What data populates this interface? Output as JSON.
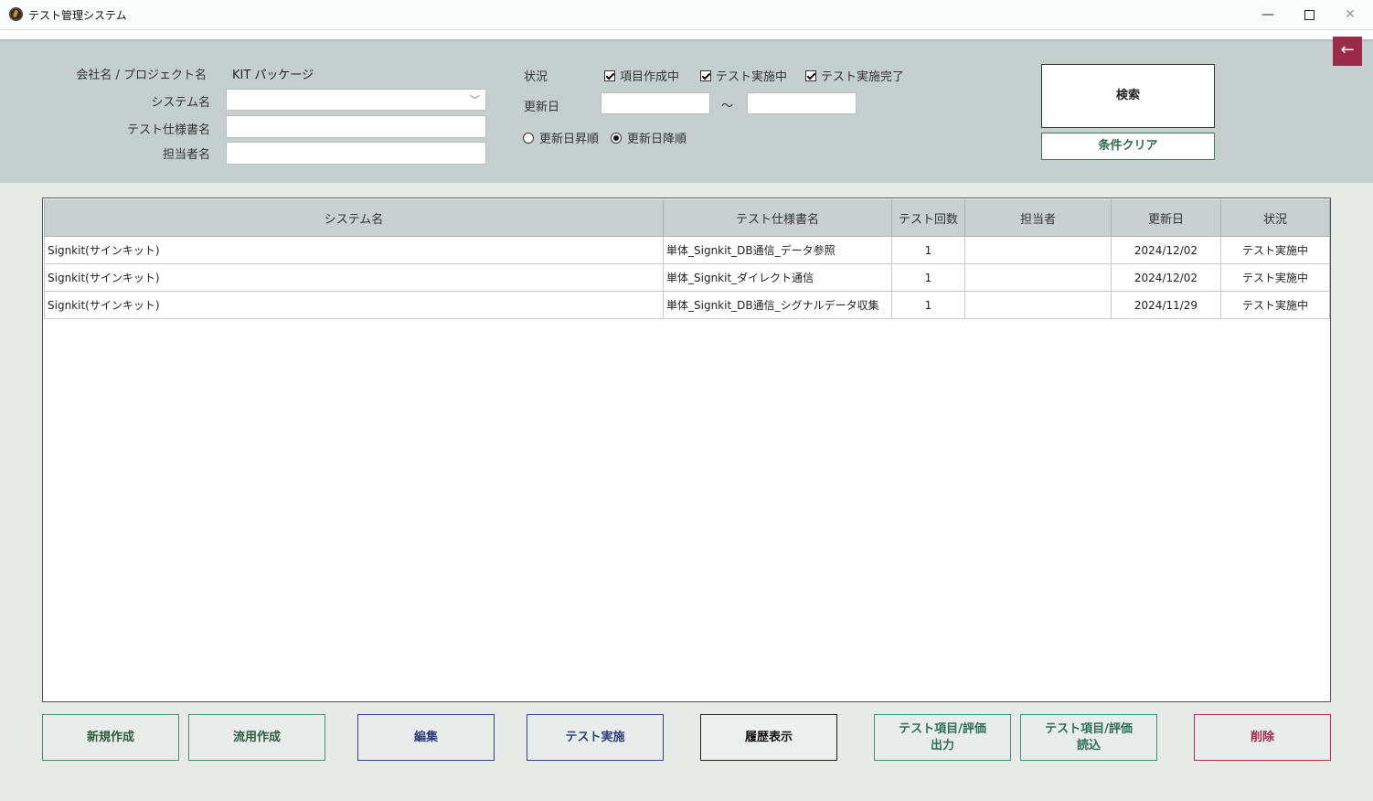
{
  "window": {
    "title": "テスト管理システム",
    "minimize": "—",
    "close": "✕"
  },
  "nav": {
    "back_glyph": "←"
  },
  "filters": {
    "company_label": "会社名 / プロジェクト名",
    "company_value": "KIT パッケージ",
    "system_label": "システム名",
    "system_value": "",
    "spec_label": "テスト仕様書名",
    "spec_value": "",
    "owner_label": "担当者名",
    "owner_value": "",
    "status_label": "状況",
    "status_options": [
      {
        "label": "項目作成中",
        "checked": true
      },
      {
        "label": "テスト実施中",
        "checked": true
      },
      {
        "label": "テスト実施完了",
        "checked": true
      }
    ],
    "date_label": "更新日",
    "date_from": "",
    "date_to": "",
    "date_sep": "～",
    "sort_options": [
      {
        "label": "更新日昇順",
        "selected": false
      },
      {
        "label": "更新日降順",
        "selected": true
      }
    ],
    "search_label": "検索",
    "clear_label": "条件クリア"
  },
  "grid": {
    "columns": [
      "システム名",
      "テスト仕様書名",
      "テスト回数",
      "担当者",
      "更新日",
      "状況"
    ],
    "rows": [
      [
        "Signkit(サインキット)",
        "単体_Signkit_DB通信_データ参照",
        "1",
        "",
        "2024/12/02",
        "テスト実施中"
      ],
      [
        "Signkit(サインキット)",
        "単体_Signkit_ダイレクト通信",
        "1",
        "",
        "2024/12/02",
        "テスト実施中"
      ],
      [
        "Signkit(サインキット)",
        "単体_Signkit_DB通信_シグナルデータ収集",
        "1",
        "",
        "2024/11/29",
        "テスト実施中"
      ]
    ]
  },
  "actions": {
    "new": "新規作成",
    "copy": "流用作成",
    "edit": "編集",
    "run": "テスト実施",
    "history": "履歴表示",
    "export_line1": "テスト項目/評価",
    "export_line2": "出力",
    "import_line1": "テスト項目/評価",
    "import_line2": "読込",
    "delete": "削除"
  }
}
